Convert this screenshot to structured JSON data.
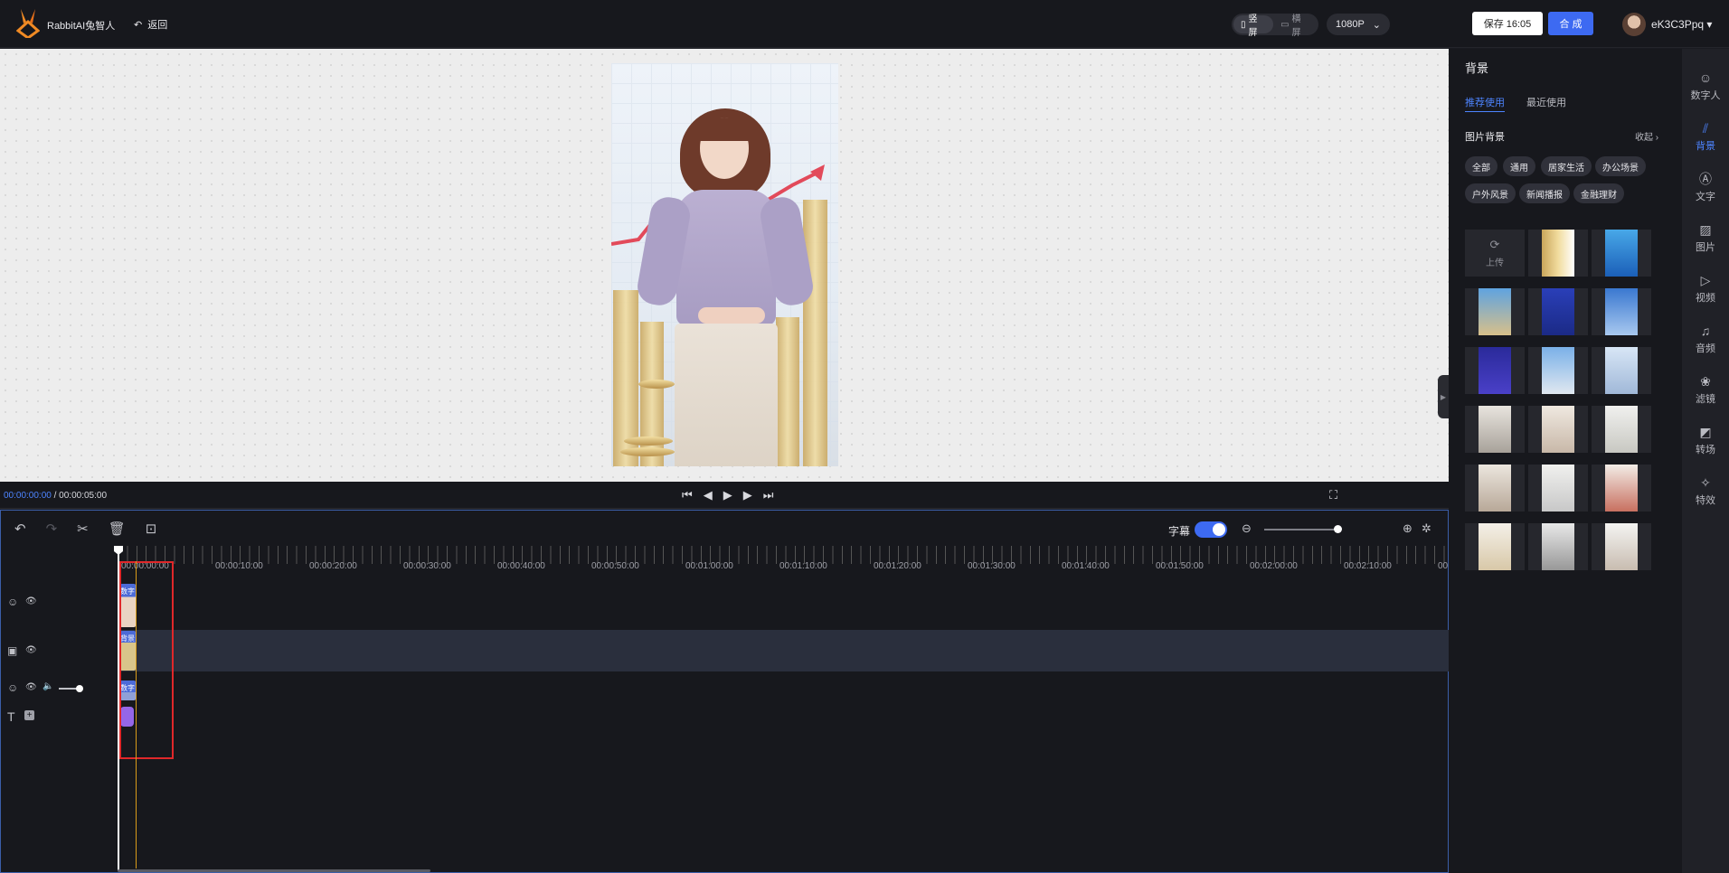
{
  "header": {
    "app_name": "RabbitAI兔智人",
    "back_label": "返回",
    "orientation": {
      "portrait": "竖屏",
      "landscape": "横屏",
      "selected": "竖屏"
    },
    "resolution": "1080P",
    "save_label": "保存 16:05",
    "compose_label": "合 成",
    "username": "eK3C3Ppq"
  },
  "player": {
    "current_time": "00:00:00:00",
    "separator": " / ",
    "total_time": "00:00:05:00"
  },
  "timeline": {
    "subtitle_label": "字幕",
    "subtitle_enabled": true,
    "zoom_level": 1.0,
    "ruler_labels": [
      "00:00:00:00",
      "00:00:10:00",
      "00:00:20:00",
      "00:00:30:00",
      "00:00:40:00",
      "00:00:50:00",
      "00:01:00:00",
      "00:01:10:00",
      "00:01:20:00",
      "00:01:30:00",
      "00:01:40:00",
      "00:01:50:00",
      "00:02:00:00",
      "00:02:10:00",
      "00:0"
    ],
    "clip_labels": {
      "avatar": "数字",
      "background": "背景",
      "avatar2": "数字"
    }
  },
  "panel": {
    "title": "背景",
    "tabs": [
      "推荐使用",
      "最近使用"
    ],
    "active_tab": "推荐使用",
    "section_title": "图片背景",
    "collapse_label": "收起",
    "chips": [
      "全部",
      "通用",
      "居家生活",
      "办公场景",
      "户外风景",
      "新闻播报",
      "金融理财"
    ],
    "upload_label": "上传",
    "thumb_count": 17
  },
  "rail": {
    "items": [
      {
        "label": "数字人",
        "icon": "avatar-icon"
      },
      {
        "label": "背景",
        "icon": "background-icon"
      },
      {
        "label": "文字",
        "icon": "text-icon"
      },
      {
        "label": "图片",
        "icon": "image-icon"
      },
      {
        "label": "视频",
        "icon": "video-icon"
      },
      {
        "label": "音频",
        "icon": "headphones-icon"
      },
      {
        "label": "滤镜",
        "icon": "filter-icon"
      },
      {
        "label": "转场",
        "icon": "transition-icon"
      },
      {
        "label": "特效",
        "icon": "effects-icon"
      }
    ],
    "active": "背景"
  },
  "colors": {
    "accent": "#3d6af2",
    "highlight_box": "#e0282a",
    "playhead_line": "#d99c1a"
  }
}
